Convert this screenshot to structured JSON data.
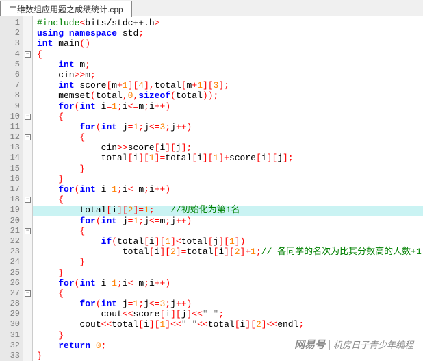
{
  "tab": {
    "title": "二维数组应用题之成绩统计.cpp"
  },
  "gutter": {
    "start": 1,
    "end": 33
  },
  "fold": [
    "",
    "",
    "",
    "-",
    "",
    "",
    "",
    "",
    "",
    "-",
    "",
    "-",
    "",
    "",
    "",
    "",
    "",
    "-",
    "",
    "",
    "-",
    "",
    "",
    "",
    "",
    "",
    "-",
    "",
    "",
    "",
    "",
    "",
    ""
  ],
  "highlight_line": 19,
  "code": [
    [
      {
        "c": "pp",
        "t": "#include"
      },
      {
        "c": "op",
        "t": "<"
      },
      {
        "c": "sys",
        "t": "bits/stdc++.h"
      },
      {
        "c": "op",
        "t": ">"
      }
    ],
    [
      {
        "c": "kw",
        "t": "using"
      },
      {
        "c": "pn",
        "t": " "
      },
      {
        "c": "kw",
        "t": "namespace"
      },
      {
        "c": "pn",
        "t": " std"
      },
      {
        "c": "op",
        "t": ";"
      }
    ],
    [
      {
        "c": "kw",
        "t": "int"
      },
      {
        "c": "pn",
        "t": " main"
      },
      {
        "c": "op",
        "t": "()"
      }
    ],
    [
      {
        "c": "op",
        "t": "{"
      }
    ],
    [
      {
        "c": "pn",
        "t": "    "
      },
      {
        "c": "kw",
        "t": "int"
      },
      {
        "c": "pn",
        "t": " m"
      },
      {
        "c": "op",
        "t": ";"
      }
    ],
    [
      {
        "c": "pn",
        "t": "    cin"
      },
      {
        "c": "op",
        "t": ">>"
      },
      {
        "c": "pn",
        "t": "m"
      },
      {
        "c": "op",
        "t": ";"
      }
    ],
    [
      {
        "c": "pn",
        "t": "    "
      },
      {
        "c": "kw",
        "t": "int"
      },
      {
        "c": "pn",
        "t": " score"
      },
      {
        "c": "op",
        "t": "["
      },
      {
        "c": "pn",
        "t": "m"
      },
      {
        "c": "op",
        "t": "+"
      },
      {
        "c": "num",
        "t": "1"
      },
      {
        "c": "op",
        "t": "]["
      },
      {
        "c": "num",
        "t": "4"
      },
      {
        "c": "op",
        "t": "],"
      },
      {
        "c": "pn",
        "t": "total"
      },
      {
        "c": "op",
        "t": "["
      },
      {
        "c": "pn",
        "t": "m"
      },
      {
        "c": "op",
        "t": "+"
      },
      {
        "c": "num",
        "t": "1"
      },
      {
        "c": "op",
        "t": "]["
      },
      {
        "c": "num",
        "t": "3"
      },
      {
        "c": "op",
        "t": "];"
      }
    ],
    [
      {
        "c": "pn",
        "t": "    memset"
      },
      {
        "c": "op",
        "t": "("
      },
      {
        "c": "pn",
        "t": "total"
      },
      {
        "c": "op",
        "t": ","
      },
      {
        "c": "num",
        "t": "0"
      },
      {
        "c": "op",
        "t": ","
      },
      {
        "c": "kw",
        "t": "sizeof"
      },
      {
        "c": "op",
        "t": "("
      },
      {
        "c": "pn",
        "t": "total"
      },
      {
        "c": "op",
        "t": "));"
      }
    ],
    [
      {
        "c": "pn",
        "t": "    "
      },
      {
        "c": "kw",
        "t": "for"
      },
      {
        "c": "op",
        "t": "("
      },
      {
        "c": "kw",
        "t": "int"
      },
      {
        "c": "pn",
        "t": " i"
      },
      {
        "c": "op",
        "t": "="
      },
      {
        "c": "num",
        "t": "1"
      },
      {
        "c": "op",
        "t": ";"
      },
      {
        "c": "pn",
        "t": "i"
      },
      {
        "c": "op",
        "t": "<="
      },
      {
        "c": "pn",
        "t": "m"
      },
      {
        "c": "op",
        "t": ";"
      },
      {
        "c": "pn",
        "t": "i"
      },
      {
        "c": "op",
        "t": "++)"
      }
    ],
    [
      {
        "c": "pn",
        "t": "    "
      },
      {
        "c": "op",
        "t": "{"
      }
    ],
    [
      {
        "c": "pn",
        "t": "        "
      },
      {
        "c": "kw",
        "t": "for"
      },
      {
        "c": "op",
        "t": "("
      },
      {
        "c": "kw",
        "t": "int"
      },
      {
        "c": "pn",
        "t": " j"
      },
      {
        "c": "op",
        "t": "="
      },
      {
        "c": "num",
        "t": "1"
      },
      {
        "c": "op",
        "t": ";"
      },
      {
        "c": "pn",
        "t": "j"
      },
      {
        "c": "op",
        "t": "<="
      },
      {
        "c": "num",
        "t": "3"
      },
      {
        "c": "op",
        "t": ";"
      },
      {
        "c": "pn",
        "t": "j"
      },
      {
        "c": "op",
        "t": "++)"
      }
    ],
    [
      {
        "c": "pn",
        "t": "        "
      },
      {
        "c": "op",
        "t": "{"
      }
    ],
    [
      {
        "c": "pn",
        "t": "            cin"
      },
      {
        "c": "op",
        "t": ">>"
      },
      {
        "c": "pn",
        "t": "score"
      },
      {
        "c": "op",
        "t": "["
      },
      {
        "c": "pn",
        "t": "i"
      },
      {
        "c": "op",
        "t": "]["
      },
      {
        "c": "pn",
        "t": "j"
      },
      {
        "c": "op",
        "t": "];"
      }
    ],
    [
      {
        "c": "pn",
        "t": "            total"
      },
      {
        "c": "op",
        "t": "["
      },
      {
        "c": "pn",
        "t": "i"
      },
      {
        "c": "op",
        "t": "]["
      },
      {
        "c": "num",
        "t": "1"
      },
      {
        "c": "op",
        "t": "]="
      },
      {
        "c": "pn",
        "t": "total"
      },
      {
        "c": "op",
        "t": "["
      },
      {
        "c": "pn",
        "t": "i"
      },
      {
        "c": "op",
        "t": "]["
      },
      {
        "c": "num",
        "t": "1"
      },
      {
        "c": "op",
        "t": "]+"
      },
      {
        "c": "pn",
        "t": "score"
      },
      {
        "c": "op",
        "t": "["
      },
      {
        "c": "pn",
        "t": "i"
      },
      {
        "c": "op",
        "t": "]["
      },
      {
        "c": "pn",
        "t": "j"
      },
      {
        "c": "op",
        "t": "];"
      }
    ],
    [
      {
        "c": "pn",
        "t": "        "
      },
      {
        "c": "op",
        "t": "}"
      }
    ],
    [
      {
        "c": "pn",
        "t": "    "
      },
      {
        "c": "op",
        "t": "}"
      }
    ],
    [
      {
        "c": "pn",
        "t": "    "
      },
      {
        "c": "kw",
        "t": "for"
      },
      {
        "c": "op",
        "t": "("
      },
      {
        "c": "kw",
        "t": "int"
      },
      {
        "c": "pn",
        "t": " i"
      },
      {
        "c": "op",
        "t": "="
      },
      {
        "c": "num",
        "t": "1"
      },
      {
        "c": "op",
        "t": ";"
      },
      {
        "c": "pn",
        "t": "i"
      },
      {
        "c": "op",
        "t": "<="
      },
      {
        "c": "pn",
        "t": "m"
      },
      {
        "c": "op",
        "t": ";"
      },
      {
        "c": "pn",
        "t": "i"
      },
      {
        "c": "op",
        "t": "++)"
      }
    ],
    [
      {
        "c": "pn",
        "t": "    "
      },
      {
        "c": "op",
        "t": "{"
      }
    ],
    [
      {
        "c": "pn",
        "t": "        total"
      },
      {
        "c": "op",
        "t": "["
      },
      {
        "c": "pn",
        "t": "i"
      },
      {
        "c": "op",
        "t": "]["
      },
      {
        "c": "num",
        "t": "2"
      },
      {
        "c": "op",
        "t": "]="
      },
      {
        "c": "num",
        "t": "1"
      },
      {
        "c": "op",
        "t": ";"
      },
      {
        "c": "pn",
        "t": "   "
      },
      {
        "c": "cmt",
        "t": "//初始化为第1名"
      }
    ],
    [
      {
        "c": "pn",
        "t": "        "
      },
      {
        "c": "kw",
        "t": "for"
      },
      {
        "c": "op",
        "t": "("
      },
      {
        "c": "kw",
        "t": "int"
      },
      {
        "c": "pn",
        "t": " j"
      },
      {
        "c": "op",
        "t": "="
      },
      {
        "c": "num",
        "t": "1"
      },
      {
        "c": "op",
        "t": ";"
      },
      {
        "c": "pn",
        "t": "j"
      },
      {
        "c": "op",
        "t": "<="
      },
      {
        "c": "pn",
        "t": "m"
      },
      {
        "c": "op",
        "t": ";"
      },
      {
        "c": "pn",
        "t": "j"
      },
      {
        "c": "op",
        "t": "++)"
      }
    ],
    [
      {
        "c": "pn",
        "t": "        "
      },
      {
        "c": "op",
        "t": "{"
      }
    ],
    [
      {
        "c": "pn",
        "t": "            "
      },
      {
        "c": "kw",
        "t": "if"
      },
      {
        "c": "op",
        "t": "("
      },
      {
        "c": "pn",
        "t": "total"
      },
      {
        "c": "op",
        "t": "["
      },
      {
        "c": "pn",
        "t": "i"
      },
      {
        "c": "op",
        "t": "]["
      },
      {
        "c": "num",
        "t": "1"
      },
      {
        "c": "op",
        "t": "]<"
      },
      {
        "c": "pn",
        "t": "total"
      },
      {
        "c": "op",
        "t": "["
      },
      {
        "c": "pn",
        "t": "j"
      },
      {
        "c": "op",
        "t": "]["
      },
      {
        "c": "num",
        "t": "1"
      },
      {
        "c": "op",
        "t": "])"
      }
    ],
    [
      {
        "c": "pn",
        "t": "                total"
      },
      {
        "c": "op",
        "t": "["
      },
      {
        "c": "pn",
        "t": "i"
      },
      {
        "c": "op",
        "t": "]["
      },
      {
        "c": "num",
        "t": "2"
      },
      {
        "c": "op",
        "t": "]="
      },
      {
        "c": "pn",
        "t": "total"
      },
      {
        "c": "op",
        "t": "["
      },
      {
        "c": "pn",
        "t": "i"
      },
      {
        "c": "op",
        "t": "]["
      },
      {
        "c": "num",
        "t": "2"
      },
      {
        "c": "op",
        "t": "]+"
      },
      {
        "c": "num",
        "t": "1"
      },
      {
        "c": "op",
        "t": ";"
      },
      {
        "c": "cmt",
        "t": "// 各同学的名次为比其分数高的人数+1"
      }
    ],
    [
      {
        "c": "pn",
        "t": "        "
      },
      {
        "c": "op",
        "t": "}"
      }
    ],
    [
      {
        "c": "pn",
        "t": "    "
      },
      {
        "c": "op",
        "t": "}"
      }
    ],
    [
      {
        "c": "pn",
        "t": "    "
      },
      {
        "c": "kw",
        "t": "for"
      },
      {
        "c": "op",
        "t": "("
      },
      {
        "c": "kw",
        "t": "int"
      },
      {
        "c": "pn",
        "t": " i"
      },
      {
        "c": "op",
        "t": "="
      },
      {
        "c": "num",
        "t": "1"
      },
      {
        "c": "op",
        "t": ";"
      },
      {
        "c": "pn",
        "t": "i"
      },
      {
        "c": "op",
        "t": "<="
      },
      {
        "c": "pn",
        "t": "m"
      },
      {
        "c": "op",
        "t": ";"
      },
      {
        "c": "pn",
        "t": "i"
      },
      {
        "c": "op",
        "t": "++)"
      }
    ],
    [
      {
        "c": "pn",
        "t": "    "
      },
      {
        "c": "op",
        "t": "{"
      }
    ],
    [
      {
        "c": "pn",
        "t": "        "
      },
      {
        "c": "kw",
        "t": "for"
      },
      {
        "c": "op",
        "t": "("
      },
      {
        "c": "kw",
        "t": "int"
      },
      {
        "c": "pn",
        "t": " j"
      },
      {
        "c": "op",
        "t": "="
      },
      {
        "c": "num",
        "t": "1"
      },
      {
        "c": "op",
        "t": ";"
      },
      {
        "c": "pn",
        "t": "j"
      },
      {
        "c": "op",
        "t": "<="
      },
      {
        "c": "num",
        "t": "3"
      },
      {
        "c": "op",
        "t": ";"
      },
      {
        "c": "pn",
        "t": "j"
      },
      {
        "c": "op",
        "t": "++)"
      }
    ],
    [
      {
        "c": "pn",
        "t": "            cout"
      },
      {
        "c": "op",
        "t": "<<"
      },
      {
        "c": "pn",
        "t": "score"
      },
      {
        "c": "op",
        "t": "["
      },
      {
        "c": "pn",
        "t": "i"
      },
      {
        "c": "op",
        "t": "]["
      },
      {
        "c": "pn",
        "t": "j"
      },
      {
        "c": "op",
        "t": "]<<"
      },
      {
        "c": "str",
        "t": "\" \""
      },
      {
        "c": "op",
        "t": ";"
      }
    ],
    [
      {
        "c": "pn",
        "t": "        cout"
      },
      {
        "c": "op",
        "t": "<<"
      },
      {
        "c": "pn",
        "t": "total"
      },
      {
        "c": "op",
        "t": "["
      },
      {
        "c": "pn",
        "t": "i"
      },
      {
        "c": "op",
        "t": "]["
      },
      {
        "c": "num",
        "t": "1"
      },
      {
        "c": "op",
        "t": "]<<"
      },
      {
        "c": "str",
        "t": "\" \""
      },
      {
        "c": "op",
        "t": "<<"
      },
      {
        "c": "pn",
        "t": "total"
      },
      {
        "c": "op",
        "t": "["
      },
      {
        "c": "pn",
        "t": "i"
      },
      {
        "c": "op",
        "t": "]["
      },
      {
        "c": "num",
        "t": "2"
      },
      {
        "c": "op",
        "t": "]<<"
      },
      {
        "c": "pn",
        "t": "endl"
      },
      {
        "c": "op",
        "t": ";"
      }
    ],
    [
      {
        "c": "pn",
        "t": "    "
      },
      {
        "c": "op",
        "t": "}"
      }
    ],
    [
      {
        "c": "pn",
        "t": "    "
      },
      {
        "c": "kw",
        "t": "return"
      },
      {
        "c": "pn",
        "t": " "
      },
      {
        "c": "num",
        "t": "0"
      },
      {
        "c": "op",
        "t": ";"
      }
    ],
    [
      {
        "c": "op",
        "t": "}"
      }
    ]
  ],
  "watermark": {
    "left": "网易号",
    "sep": "|",
    "right": "机房日子青少年编程"
  }
}
